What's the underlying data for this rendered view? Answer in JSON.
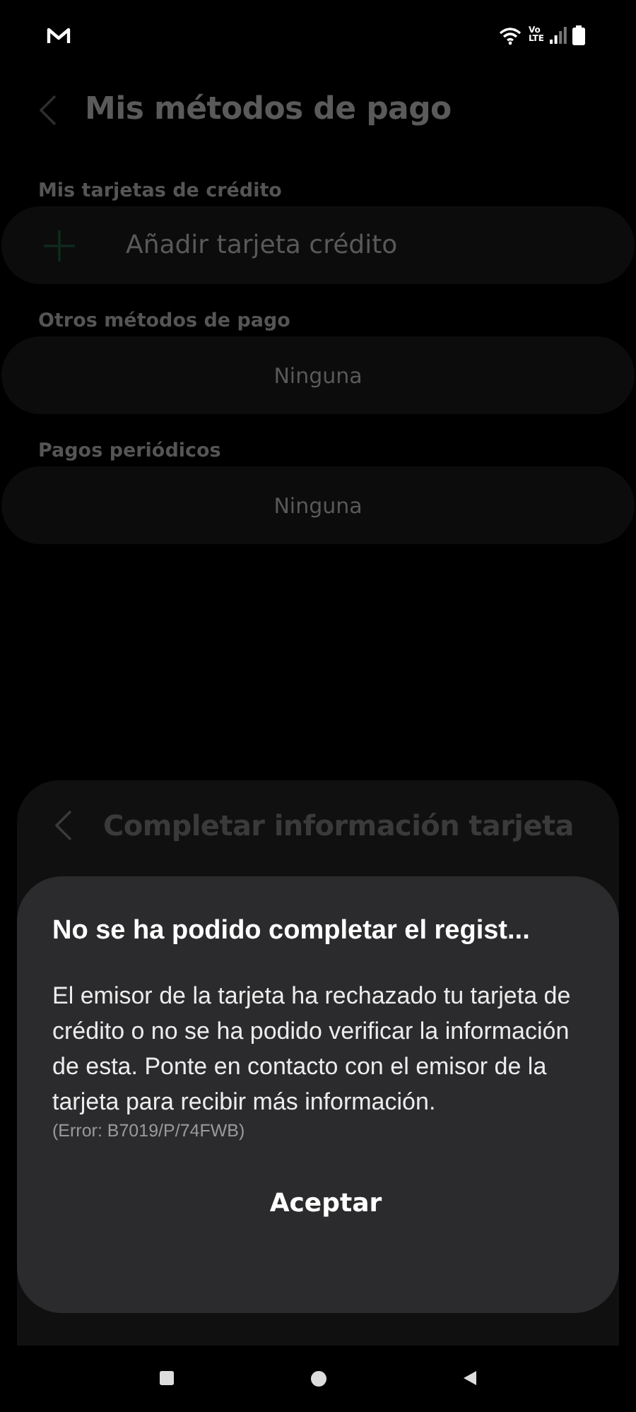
{
  "status_bar": {
    "network_top": "Vo",
    "network_bottom": "LTE"
  },
  "screen": {
    "title": "Mis métodos de pago",
    "sections": [
      {
        "title": "Mis tarjetas de crédito",
        "kind": "action",
        "label": "Añadir tarjeta crédito"
      },
      {
        "title": "Otros métodos de pago",
        "kind": "empty",
        "label": "Ninguna"
      },
      {
        "title": "Pagos periódicos",
        "kind": "empty",
        "label": "Ninguna"
      }
    ]
  },
  "sheet": {
    "title": "Completar información tarjeta"
  },
  "dialog": {
    "title": "No se ha podido completar el regist...",
    "message": "El emisor de la tarjeta ha rechazado tu tarjeta de crédito o no se ha podido verificar la información de esta. Ponte en contacto con el emisor de la tarjeta para recibir más información.",
    "error": "(Error: B7019/P/74FWB)",
    "button": "Aceptar"
  }
}
